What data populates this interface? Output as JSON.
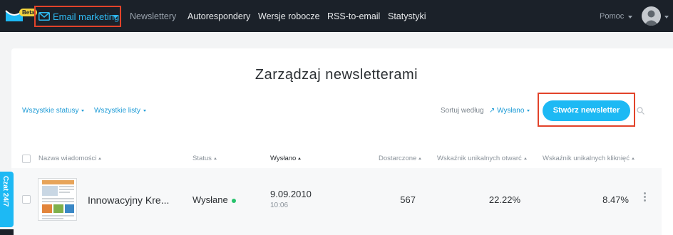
{
  "header": {
    "beta_badge": "Beta",
    "active_nav": "Email marketing",
    "nav": [
      "Newslettery",
      "Autorespondery",
      "Wersje robocze",
      "RSS-to-email",
      "Statystyki"
    ],
    "help": "Pomoc",
    "accent": "#2fb8ef",
    "background": "#1b2129"
  },
  "main": {
    "title": "Zarządzaj newsletterami",
    "filters": [
      "Wszystkie statusy",
      "Wszystkie listy"
    ],
    "sort_label": "Sortuj według",
    "sort_value": "↗ Wysłano",
    "create_button": "Stwórz newsletter",
    "columns": [
      "Nazwa wiadomości",
      "Status",
      "Wysłano",
      "Dostarczone",
      "Wskaźnik unikalnych otwarć",
      "Wskaźnik unikalnych kliknięć"
    ],
    "rows": [
      {
        "name": "Innowacyjny Kre...",
        "status": "Wysłane",
        "date": "9.09.2010",
        "time": "10:06",
        "delivered": "567",
        "open_rate": "22.22%",
        "click_rate": "8.47%"
      }
    ]
  },
  "chat": {
    "label": "Czat 24/7"
  },
  "icons": [
    "logo-icon",
    "mail-icon",
    "search-icon",
    "avatar-icon",
    "more-icon"
  ]
}
